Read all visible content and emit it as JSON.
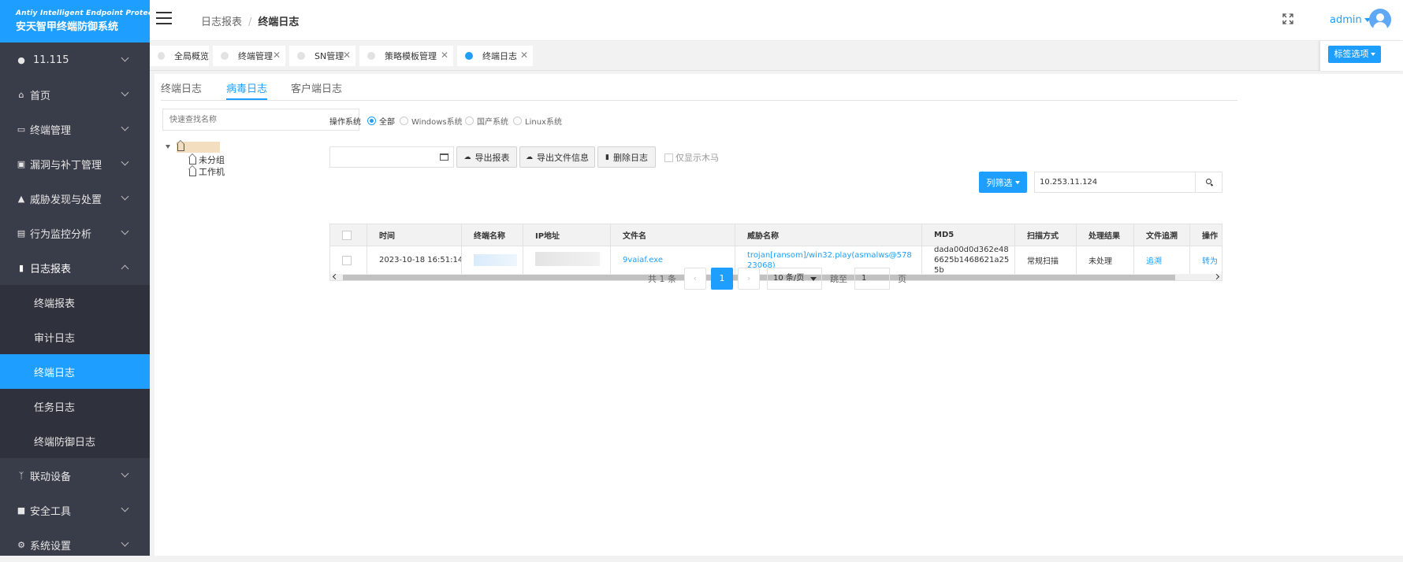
{
  "app": {
    "logo_en": "Antiy Intelligent Endpoint Protection",
    "logo_cn": "安天智甲终端防御系统"
  },
  "sidebar": {
    "items": [
      {
        "label": "11.115",
        "icon": "location-pin-icon"
      },
      {
        "label": "首页",
        "icon": "home-icon"
      },
      {
        "label": "终端管理",
        "icon": "monitor-icon"
      },
      {
        "label": "漏洞与补丁管理",
        "icon": "lock-icon"
      },
      {
        "label": "威胁发现与处置",
        "icon": "warning-icon"
      },
      {
        "label": "行为监控分析",
        "icon": "chart-icon"
      },
      {
        "label": "日志报表",
        "icon": "bar-chart-icon"
      }
    ],
    "sub_items": [
      "终端报表",
      "审计日志",
      "终端日志",
      "任务日志",
      "终端防御日志"
    ],
    "active_sub": "终端日志",
    "bottom_items": [
      {
        "label": "联动设备",
        "icon": "branch-icon"
      },
      {
        "label": "安全工具",
        "icon": "toolbox-icon"
      },
      {
        "label": "系统设置",
        "icon": "gear-icon"
      }
    ]
  },
  "header": {
    "breadcrumb_parent": "日志报表",
    "breadcrumb_separator": "/",
    "breadcrumb_current": "终端日志",
    "user": "admin"
  },
  "page_tabs": [
    {
      "label": "全局概览",
      "closable": false
    },
    {
      "label": "终端管理",
      "closable": true
    },
    {
      "label": "SN管理",
      "closable": true
    },
    {
      "label": "策略模板管理",
      "closable": true
    },
    {
      "label": "终端日志",
      "closable": true,
      "active": true
    }
  ],
  "tag_options_label": "标签选项",
  "sub_tabs": [
    "终端日志",
    "病毒日志",
    "客户端日志"
  ],
  "active_sub_tab": "病毒日志",
  "tree": {
    "search_placeholder": "快速查找名称",
    "children": [
      "未分组",
      "工作机"
    ]
  },
  "filters": {
    "os_label": "操作系统",
    "os_options": [
      "全部",
      "Windows系统",
      "国产系统",
      "Linux系统"
    ],
    "os_selected": "全部",
    "export_report": "导出报表",
    "export_file_info": "导出文件信息",
    "delete_log": "删除日志",
    "trojan_only": "仅显示木马",
    "column_filter": "列筛选",
    "search_value": "10.253.11.124"
  },
  "table": {
    "columns": [
      "时间",
      "终端名称",
      "IP地址",
      "文件名",
      "威胁名称",
      "MD5",
      "扫描方式",
      "处理结果",
      "文件追溯",
      "操作"
    ],
    "rows": [
      {
        "time": "2023-10-18 16:51:14",
        "terminal": "",
        "ip": "",
        "filename": "9vaiaf.exe",
        "threat": "trojan[ransom]/win32.play(asmalws@57823068)",
        "md5": "dada00d0d362e486625b1468621a255b",
        "scan_mode": "常规扫描",
        "result": "未处理",
        "trace": "追溯",
        "action": "转为"
      }
    ]
  },
  "pagination": {
    "total": "共 1 条",
    "current_page": "1",
    "per_page": "10 条/页",
    "goto_label": "跳至",
    "goto_value": "1",
    "page_unit": "页"
  },
  "colors": {
    "accent": "#1E9FFF",
    "sidebar_bg": "#393D49",
    "sidebar_sub_bg": "#2f323c"
  }
}
